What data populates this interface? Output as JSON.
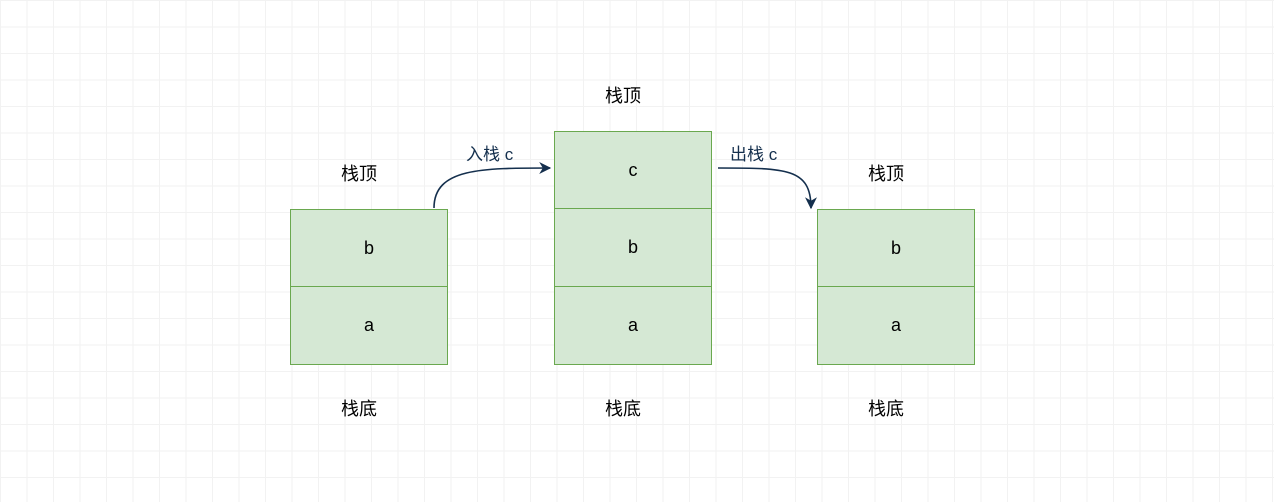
{
  "labels": {
    "top": "栈顶",
    "bottom": "栈底",
    "push": "入栈 c",
    "pop": "出栈 c"
  },
  "stacks": {
    "left": {
      "cells": [
        "b",
        "a"
      ]
    },
    "middle": {
      "cells": [
        "c",
        "b",
        "a"
      ]
    },
    "right": {
      "cells": [
        "b",
        "a"
      ]
    }
  },
  "colors": {
    "cell_fill": "#d5e8d4",
    "cell_border": "#6aa84f",
    "arrow": "#142f4d"
  }
}
